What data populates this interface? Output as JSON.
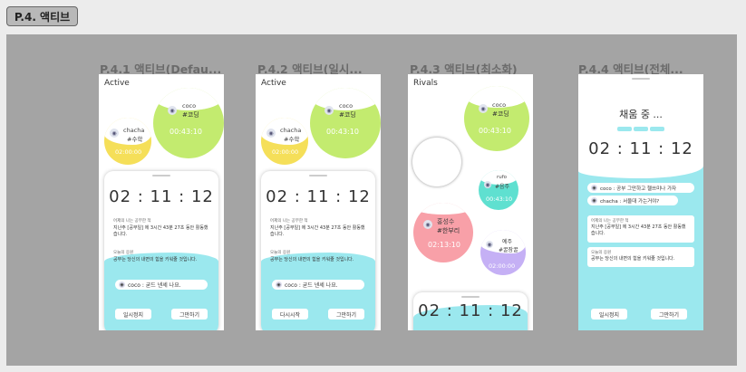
{
  "page_tag": "P.4. 액티브",
  "frames": [
    {
      "label": "P.4.1 액티브(Defau...",
      "title": "Active",
      "coco": {
        "name": "coco",
        "tag": "#코딩",
        "time": "00:43:10"
      },
      "chacha": {
        "name": "chacha",
        "tag": "#수학",
        "time": "02:00:00"
      },
      "timer": "02 : 11 : 12",
      "info_head": "어제의 나는 공부한 적",
      "info_body": "지난주 [공부일] 에 3시간 43분 27초 동안 활동했습니다.",
      "quote_head": "오늘의 응원",
      "quote_body": "공부는 당신의 내면의 힘을 키워줄 것입니다.",
      "message": "coco : 굳드 넨세 나요.",
      "btn_left": "일시정지",
      "btn_right": "그만하기"
    },
    {
      "label": "P.4.2 액티브(일시...",
      "title": "Active",
      "coco": {
        "name": "coco",
        "tag": "#코딩",
        "time": "00:43:10"
      },
      "chacha": {
        "name": "chacha",
        "tag": "#수학",
        "time": "02:00:00"
      },
      "timer": "02 : 11 : 12",
      "info_head": "어제의 나는 공부한 적",
      "info_body": "지난주 [공부일] 에 3시간 43분 27초 동안 활동했습니다.",
      "quote_head": "오늘의 응원",
      "quote_body": "공부는 당신의 내면의 힘을 키워줄 것입니다.",
      "message": "coco : 굳드 넨세 나요.",
      "btn_left": "다시시작",
      "btn_right": "그만하기"
    },
    {
      "label": "P.4.3 액티브(최소화)",
      "title": "Rivals",
      "coco": {
        "name": "coco",
        "tag": "#코딩",
        "time": "00:43:10"
      },
      "rufo": {
        "name": "rufo",
        "tag": "#음주",
        "time": "00:43:10"
      },
      "hong": {
        "name": "홍성수",
        "tag": "#한부리",
        "time": "02:13:10"
      },
      "yeju": {
        "name": "예주",
        "tag": "#꿀잠꿀",
        "time": "02:00:00"
      },
      "timer": "02 : 11 : 12"
    },
    {
      "label": "P.4.4 액티브(전체...",
      "heading": "채움 중 ...",
      "timer": "02 : 11 : 12",
      "chat1": "coco : 공부 그만하고 헬쓰미나 가자",
      "chat2": "chacha : 서울대 가는거야?",
      "info_head": "어제의 나는 공부한 적",
      "info_body": "지난주 [공부일] 에 3시간 43분 27초 동안 활동했습니다.",
      "quote_head": "오늘의 응원",
      "quote_body": "공부는 당신의 내면의 힘을 키워줄 것입니다.",
      "btn_left": "일시정지",
      "btn_right": "그만하기"
    }
  ],
  "colors": {
    "green": "#c3eb6f",
    "yellow": "#f5df59",
    "cyan": "#9be8ee",
    "pink": "#f8a0a8",
    "teal": "#5fe0d0",
    "purple": "#c5b0f5"
  }
}
